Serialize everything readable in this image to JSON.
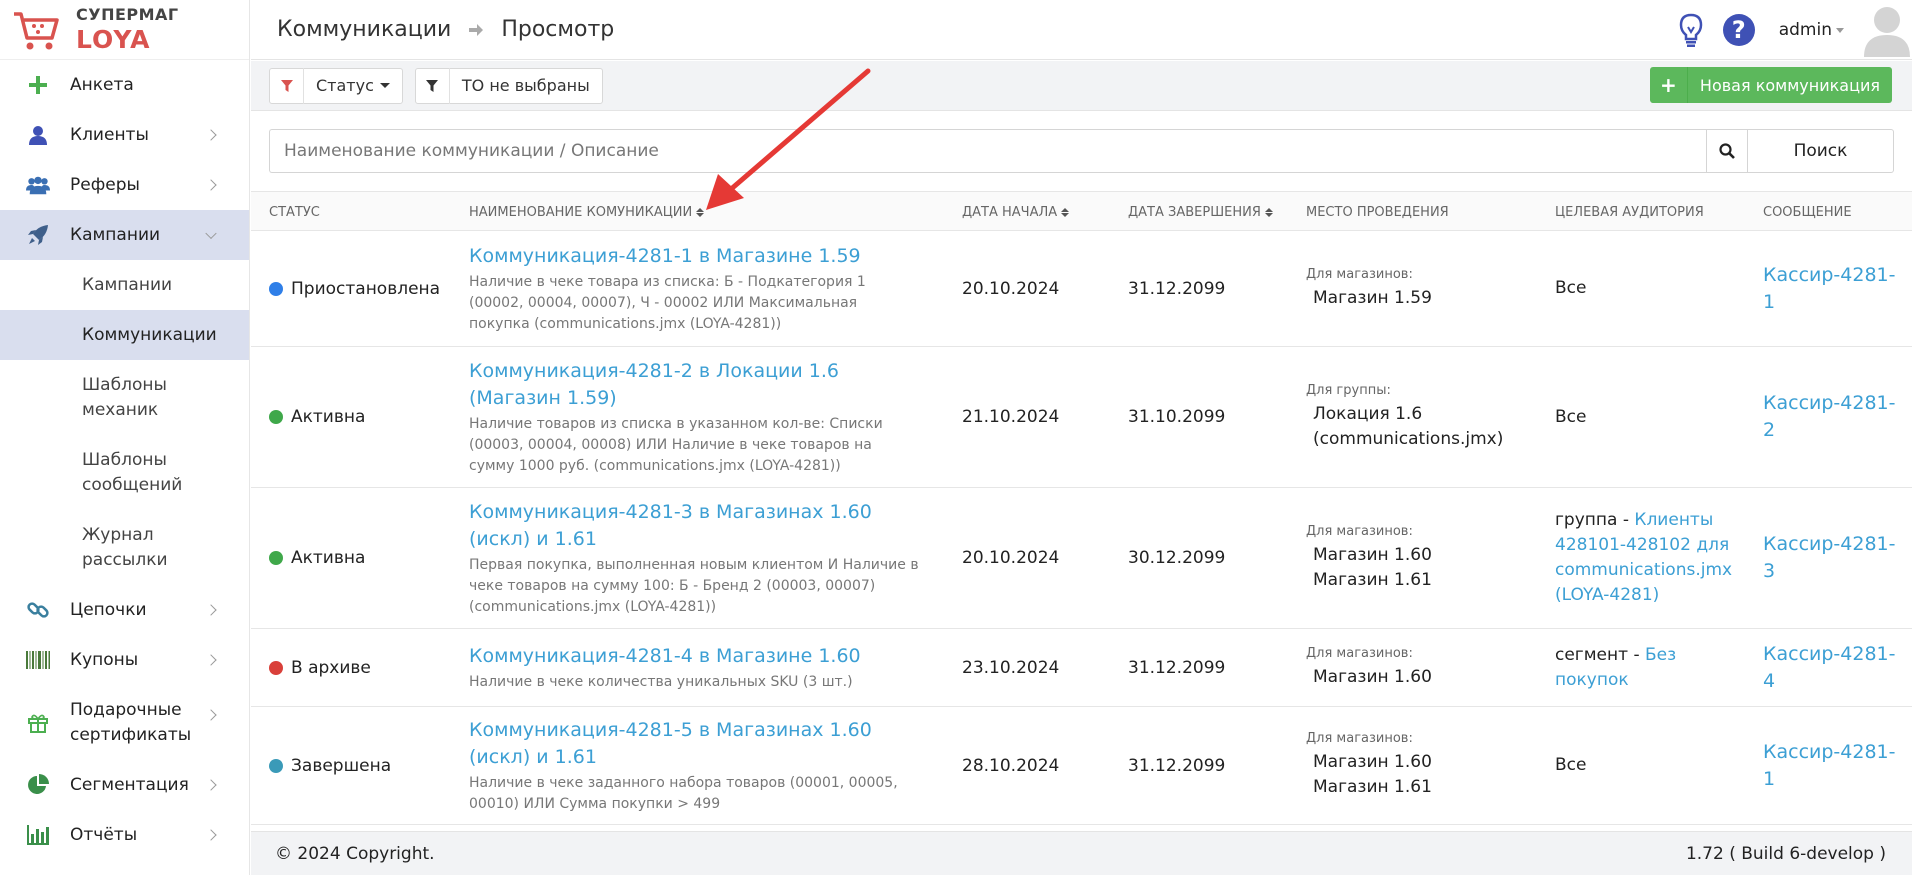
{
  "logo": {
    "top": "СУПЕРМАГ",
    "bottom": "LOYA"
  },
  "sidebar": {
    "items": [
      {
        "label": "Анкета",
        "icon": "plus-icon"
      },
      {
        "label": "Клиенты",
        "icon": "user-icon"
      },
      {
        "label": "Реферы",
        "icon": "users-icon"
      },
      {
        "label": "Кампании",
        "icon": "rocket-icon"
      },
      {
        "label": "Цепочки",
        "icon": "link-icon"
      },
      {
        "label": "Купоны",
        "icon": "barcode-icon"
      },
      {
        "label": "Подарочные сертификаты",
        "icon": "gift-icon"
      },
      {
        "label": "Сегментация",
        "icon": "pie-chart-icon"
      },
      {
        "label": "Отчёты",
        "icon": "bar-chart-icon"
      }
    ],
    "sub": [
      "Кампании",
      "Коммуникации",
      "Шаблоны механик",
      "Шаблоны сообщений",
      "Журнал рассылки"
    ]
  },
  "header": {
    "crumb1": "Коммуникации",
    "crumb2": "Просмотр",
    "user": "admin"
  },
  "toolbar": {
    "status": "Статус",
    "to": "ТО не выбраны",
    "new": "Новая коммуникация"
  },
  "search": {
    "placeholder": "Наименование коммуникации / Описание",
    "button": "Поиск"
  },
  "table": {
    "headers": [
      "СТАТУС",
      "НАИМЕНОВАНИЕ КОМУНИКАЦИИ",
      "ДАТА НАЧАЛА",
      "ДАТА ЗАВЕРШЕНИЯ",
      "МЕСТО ПРОВЕДЕНИЯ",
      "ЦЕЛЕВАЯ АУДИТОРИЯ",
      "СООБЩЕНИЕ"
    ],
    "rows": [
      {
        "status": "Приостановлена",
        "color": "#2f7fe8",
        "name": "Коммуникация-4281-1 в Магазине 1.59",
        "desc": "Наличие в чеке товара из списка: Б - Подкатегория 1 (00002, 00004, 00007), Ч - 00002 ИЛИ Максимальная покупка (communications.jmx (LOYA-4281))",
        "start": "20.10.2024",
        "end": "31.12.2099",
        "place_cap": "Для магазинов:",
        "place1": "Магазин 1.59",
        "place2": "",
        "aud_prefix": "Все",
        "aud_link": "",
        "msg": "Кассир-4281-1"
      },
      {
        "status": "Активна",
        "color": "#3fa84a",
        "name": "Коммуникация-4281-2 в Локации 1.6 (Магазин 1.59)",
        "desc": "Наличие товаров из списка в указанном кол-ве: Списки (00003, 00004, 00008) ИЛИ Наличие в чеке товаров на сумму 1000 руб. (communications.jmx (LOYA-4281))",
        "start": "21.10.2024",
        "end": "31.10.2099",
        "place_cap": "Для группы:",
        "place1": "Локация 1.6 (communications.jmx)",
        "place2": "",
        "aud_prefix": "Все",
        "aud_link": "",
        "msg": "Кассир-4281-2"
      },
      {
        "status": "Активна",
        "color": "#3fa84a",
        "name": "Коммуникация-4281-3 в Магазинах 1.60 (искл) и 1.61",
        "desc": "Первая покупка, выполненная новым клиентом И Наличие в чеке товаров на сумму 100: Б - Бренд 2 (00003, 00007) (communications.jmx (LOYA-4281))",
        "start": "20.10.2024",
        "end": "30.12.2099",
        "place_cap": "Для магазинов:",
        "place1": "Магазин 1.60",
        "place2": "Магазин 1.61",
        "aud_prefix": "группа - ",
        "aud_link": "Клиенты 428101-428102 для communications.jmx (LOYA-4281)",
        "msg": "Кассир-4281-3"
      },
      {
        "status": "В архиве",
        "color": "#d9403a",
        "name": "Коммуникация-4281-4 в Магазине 1.60",
        "desc": "Наличие в чеке количества уникальных SKU (3 шт.)",
        "start": "23.10.2024",
        "end": "31.12.2099",
        "place_cap": "Для магазинов:",
        "place1": "Магазин 1.60",
        "place2": "",
        "aud_prefix": "сегмент - ",
        "aud_link": "Без покупок",
        "msg": "Кассир-4281-4"
      },
      {
        "status": "Завершена",
        "color": "#3a9ab8",
        "name": "Коммуникация-4281-5 в Магазинах 1.60 (искл) и 1.61",
        "desc": "Наличие в чеке заданного набора товаров (00001, 00005, 00010) ИЛИ Сумма покупки > 499",
        "start": "28.10.2024",
        "end": "31.12.2099",
        "place_cap": "Для магазинов:",
        "place1": "Магазин 1.60",
        "place2": "Магазин 1.61",
        "aud_prefix": "Все",
        "aud_link": "",
        "msg": "Кассир-4281-1"
      }
    ]
  },
  "footer": {
    "copyright": "© 2024 Copyright.",
    "version": "1.72 ( Build 6-develop )"
  }
}
